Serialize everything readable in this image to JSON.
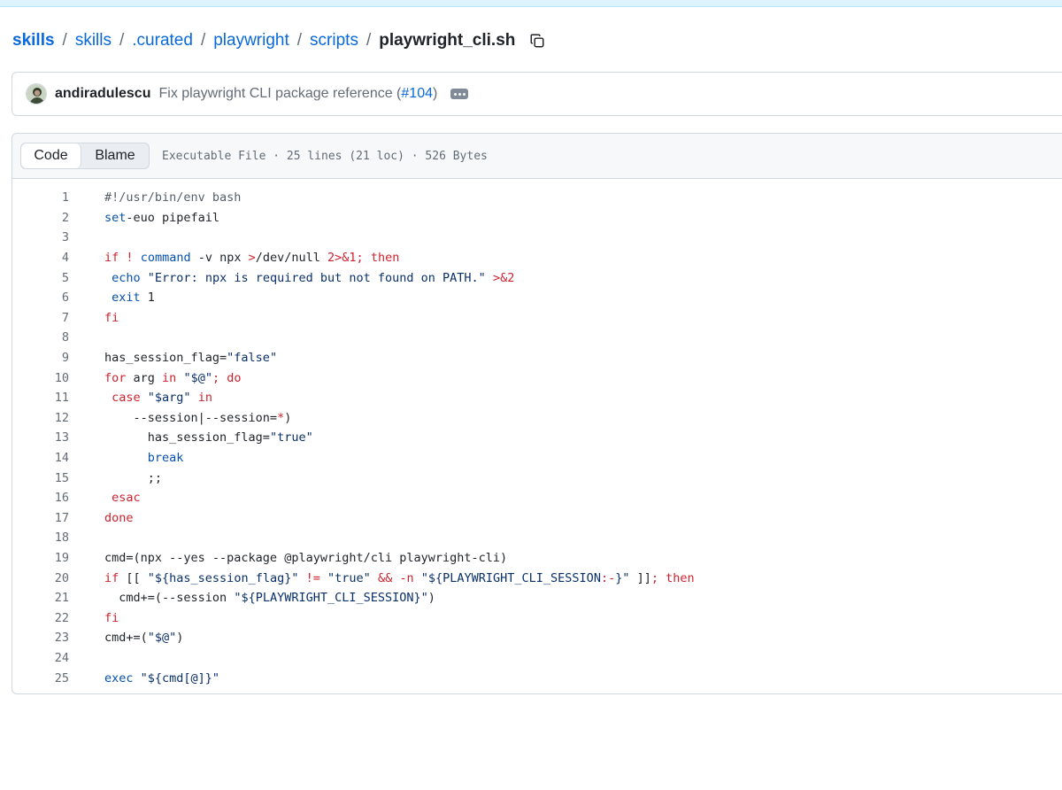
{
  "breadcrumb": {
    "items": [
      "skills",
      "skills",
      ".curated",
      "playwright",
      "scripts"
    ],
    "separator": "/",
    "current": "playwright_cli.sh"
  },
  "commit": {
    "author": "andiradulescu",
    "message_prefix": "Fix playwright CLI package reference (",
    "pr_link": "#104",
    "message_suffix": ")"
  },
  "file_header": {
    "tabs": [
      "Code",
      "Blame"
    ],
    "active_tab": "Code",
    "info": "Executable File · 25 lines (21 loc) · 526 Bytes"
  },
  "code": {
    "lines": [
      "#!/usr/bin/env bash",
      "set -euo pipefail",
      "",
      "if ! command -v npx >/dev/null 2>&1; then",
      "  echo \"Error: npx is required but not found on PATH.\" >&2",
      "  exit 1",
      "fi",
      "",
      "has_session_flag=\"false\"",
      "for arg in \"$@\"; do",
      "  case \"$arg\" in",
      "    --session|--session=*)",
      "      has_session_flag=\"true\"",
      "      break",
      "      ;;",
      "  esac",
      "done",
      "",
      "cmd=(npx --yes --package @playwright/cli playwright-cli)",
      "if [[ \"${has_session_flag}\" != \"true\" && -n \"${PLAYWRIGHT_CLI_SESSION:-}\" ]]; then",
      "  cmd+=(--session \"${PLAYWRIGHT_CLI_SESSION}\")",
      "fi",
      "cmd+=(\"$@\")",
      "",
      "exec \"${cmd[@]}\""
    ],
    "tokens": [
      [
        [
          "c",
          "#!/usr/bin/env bash"
        ]
      ],
      [
        [
          "b",
          "set"
        ],
        [
          "",
          "-euo pipefail"
        ]
      ],
      [],
      [
        [
          "k",
          "if"
        ],
        [
          "",
          " "
        ],
        [
          "k",
          "!"
        ],
        [
          "",
          " "
        ],
        [
          "b",
          "command"
        ],
        [
          "",
          " -v npx "
        ],
        [
          "k",
          ">"
        ],
        [
          "",
          "/dev/null "
        ],
        [
          "k",
          "2>&1;"
        ],
        [
          "",
          " "
        ],
        [
          "k",
          "then"
        ]
      ],
      [
        [
          "",
          " "
        ],
        [
          "b",
          "echo"
        ],
        [
          "",
          " "
        ],
        [
          "s",
          "\"Error: npx is required but not found on PATH.\""
        ],
        [
          "",
          " "
        ],
        [
          "k",
          ">&2"
        ]
      ],
      [
        [
          "",
          " "
        ],
        [
          "b",
          "exit"
        ],
        [
          "",
          " 1"
        ]
      ],
      [
        [
          "k",
          "fi"
        ]
      ],
      [],
      [
        [
          "",
          "has_session_flag="
        ],
        [
          "s",
          "\"false\""
        ]
      ],
      [
        [
          "k",
          "for"
        ],
        [
          "",
          " arg "
        ],
        [
          "k",
          "in"
        ],
        [
          "",
          " "
        ],
        [
          "s",
          "\"$@\""
        ],
        [
          "k",
          ";"
        ],
        [
          "",
          " "
        ],
        [
          "k",
          "do"
        ]
      ],
      [
        [
          "",
          " "
        ],
        [
          "k",
          "case"
        ],
        [
          "",
          " "
        ],
        [
          "s",
          "\"$arg\""
        ],
        [
          "",
          " "
        ],
        [
          "k",
          "in"
        ]
      ],
      [
        [
          "",
          "    --session|--session="
        ],
        [
          "k",
          "*"
        ],
        [
          "",
          ")"
        ]
      ],
      [
        [
          "",
          "      has_session_flag="
        ],
        [
          "s",
          "\"true\""
        ]
      ],
      [
        [
          "",
          "      "
        ],
        [
          "b",
          "break"
        ]
      ],
      [
        [
          "",
          "      ;;"
        ]
      ],
      [
        [
          "",
          " "
        ],
        [
          "k",
          "esac"
        ]
      ],
      [
        [
          "k",
          "done"
        ]
      ],
      [],
      [
        [
          "",
          "cmd=(npx --yes --package @playwright/cli playwright-cli)"
        ]
      ],
      [
        [
          "k",
          "if"
        ],
        [
          "",
          " [[ "
        ],
        [
          "s",
          "\"${has_session_flag}\""
        ],
        [
          "",
          " "
        ],
        [
          "k",
          "!="
        ],
        [
          "",
          " "
        ],
        [
          "s",
          "\"true\""
        ],
        [
          "",
          " "
        ],
        [
          "k",
          "&&"
        ],
        [
          "",
          " "
        ],
        [
          "k",
          "-n"
        ],
        [
          "",
          " "
        ],
        [
          "s",
          "\"${PLAYWRIGHT_CLI_SESSION"
        ],
        [
          "k",
          ":-"
        ],
        [
          "s",
          "}\""
        ],
        [
          "",
          " ]]"
        ],
        [
          "k",
          ";"
        ],
        [
          "",
          " "
        ],
        [
          "k",
          "then"
        ]
      ],
      [
        [
          "",
          "  cmd+=(--session "
        ],
        [
          "s",
          "\"${PLAYWRIGHT_CLI_SESSION}\""
        ],
        [
          "",
          ")"
        ]
      ],
      [
        [
          "k",
          "fi"
        ]
      ],
      [
        [
          "",
          "cmd+=("
        ],
        [
          "s",
          "\"$@\""
        ],
        [
          "",
          ")"
        ]
      ],
      [],
      [
        [
          "b",
          "exec"
        ],
        [
          "",
          " "
        ],
        [
          "s",
          "\"${cmd[@]}\""
        ]
      ]
    ]
  }
}
